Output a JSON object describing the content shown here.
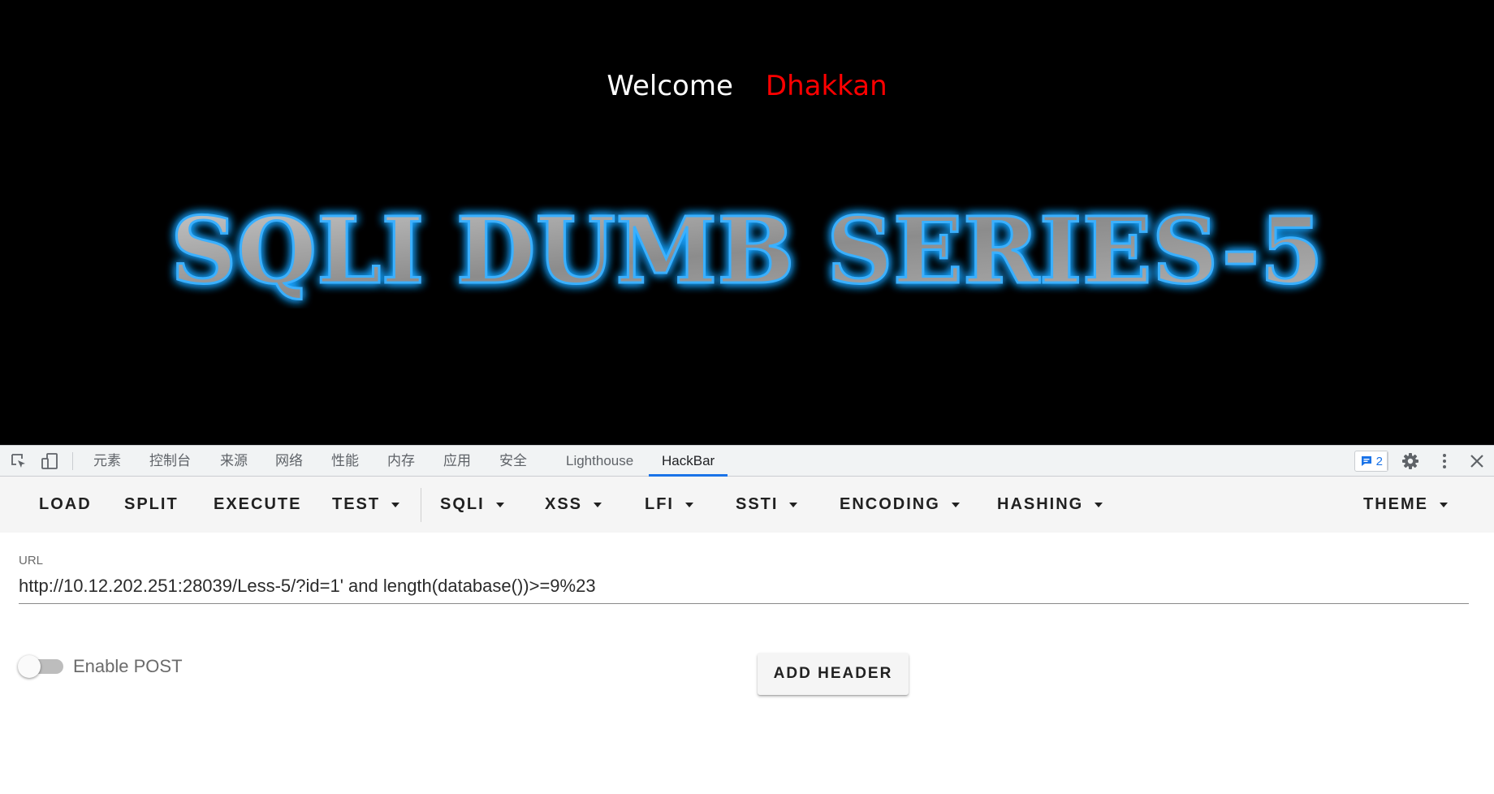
{
  "page": {
    "welcome_text": "Welcome",
    "user_name": "Dhakkan",
    "banner_text": "SQLI DUMB SERIES-5",
    "banner_fill": "#9a9a9a",
    "banner_glow": "#1aa3ff"
  },
  "devtools": {
    "tabs": [
      "元素",
      "控制台",
      "来源",
      "网络",
      "性能",
      "内存",
      "应用",
      "安全",
      "Lighthouse",
      "HackBar"
    ],
    "active_tab": "HackBar",
    "issues_count": "2",
    "icons": [
      "inspect-element-icon",
      "device-toolbar-icon",
      "issues-icon",
      "gear-icon",
      "more-vertical-icon",
      "close-icon"
    ]
  },
  "hackbar": {
    "buttons": {
      "load": "LOAD",
      "split": "SPLIT",
      "execute": "EXECUTE",
      "test": "TEST",
      "sqli": "SQLI",
      "xss": "XSS",
      "lfi": "LFI",
      "ssti": "SSTI",
      "encoding": "ENCODING",
      "hashing": "HASHING",
      "theme": "THEME"
    },
    "url_label": "URL",
    "url_value": "http://10.12.202.251:28039/Less-5/?id=1' and length(database())>=9%23",
    "enable_post_label": "Enable POST",
    "enable_post_on": false,
    "add_header_label": "ADD HEADER"
  }
}
